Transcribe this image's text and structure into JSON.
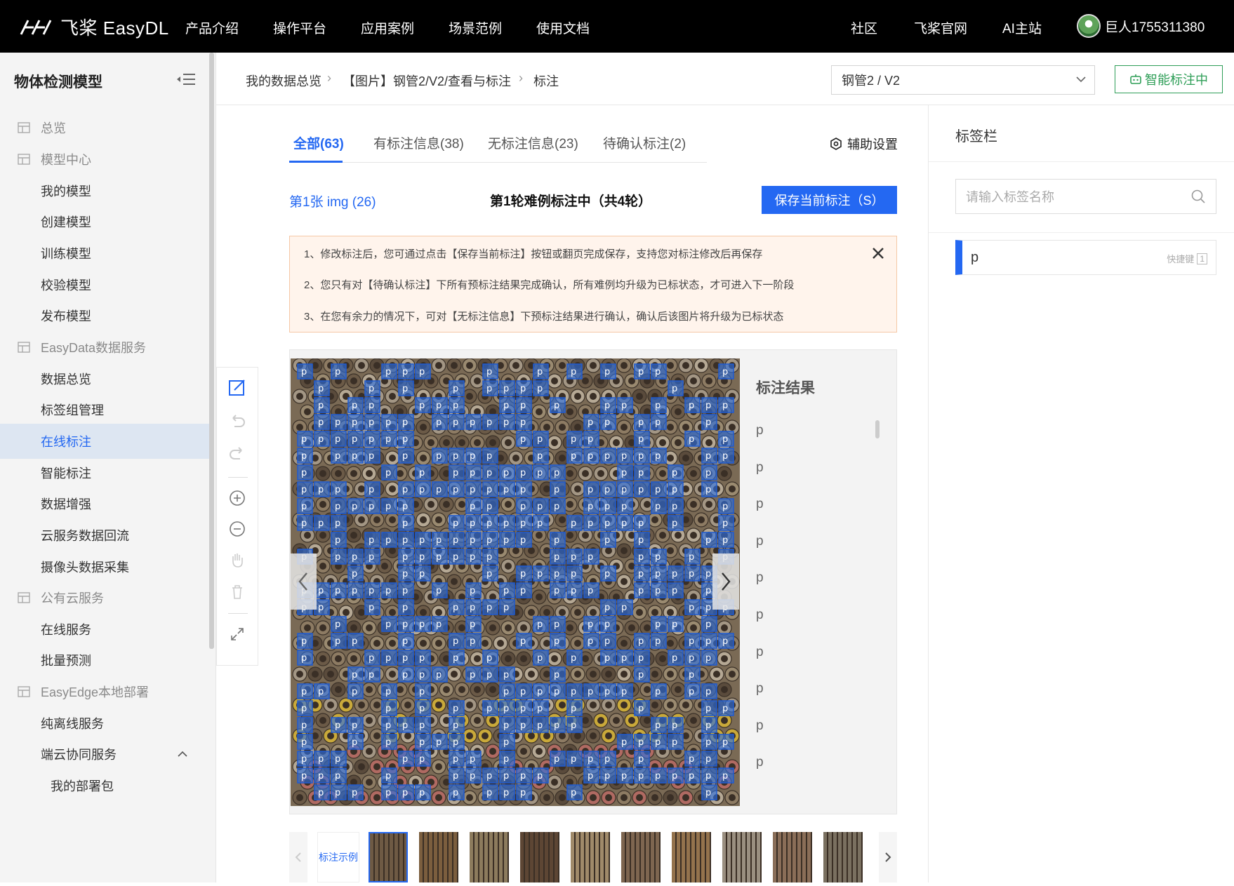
{
  "brand": {
    "logo_text": "飞桨 EasyDL"
  },
  "topnav": {
    "items": [
      "产品介绍",
      "操作平台",
      "应用案例",
      "场景范例",
      "使用文档"
    ],
    "right_items": [
      "社区",
      "飞桨官网",
      "AI主站"
    ],
    "user": "巨人1755311380"
  },
  "sidebar": {
    "title": "物体检测模型",
    "items": [
      {
        "label": "总览",
        "kind": "group"
      },
      {
        "label": "模型中心",
        "kind": "group"
      },
      {
        "label": "我的模型",
        "kind": "sub"
      },
      {
        "label": "创建模型",
        "kind": "sub"
      },
      {
        "label": "训练模型",
        "kind": "sub"
      },
      {
        "label": "校验模型",
        "kind": "sub"
      },
      {
        "label": "发布模型",
        "kind": "sub"
      },
      {
        "label": "EasyData数据服务",
        "kind": "group"
      },
      {
        "label": "数据总览",
        "kind": "sub"
      },
      {
        "label": "标签组管理",
        "kind": "sub"
      },
      {
        "label": "在线标注",
        "kind": "sub",
        "active": true
      },
      {
        "label": "智能标注",
        "kind": "sub"
      },
      {
        "label": "数据增强",
        "kind": "sub"
      },
      {
        "label": "云服务数据回流",
        "kind": "sub"
      },
      {
        "label": "摄像头数据采集",
        "kind": "sub"
      },
      {
        "label": "公有云服务",
        "kind": "group"
      },
      {
        "label": "在线服务",
        "kind": "sub"
      },
      {
        "label": "批量预测",
        "kind": "sub"
      },
      {
        "label": "EasyEdge本地部署",
        "kind": "group"
      },
      {
        "label": "纯离线服务",
        "kind": "sub"
      },
      {
        "label": "端云协同服务",
        "kind": "sub"
      },
      {
        "label": "我的部署包",
        "kind": "sub2"
      }
    ]
  },
  "breadcrumb": [
    "我的数据总览",
    "【图片】钢管2/V2/查看与标注",
    "标注"
  ],
  "version_select": {
    "value": "钢管2 / V2"
  },
  "smart_label_button": "智能标注中",
  "tabs": [
    {
      "label": "全部(63)",
      "active": true
    },
    {
      "label": "有标注信息(38)"
    },
    {
      "label": "无标注信息(23)"
    },
    {
      "label": "待确认标注(2)"
    }
  ],
  "assist_settings": "辅助设置",
  "image_index": "第1张 img (26)",
  "round_status": "第1轮难例标注中（共4轮）",
  "save_button": "保存当前标注（S）",
  "notice": [
    "1、修改标注后，您可通过点击【保存当前标注】按钮或翻页完成保存，支持您对标注修改后再保存",
    "2、您只有对【待确认标注】下所有预标注结果完成确认，所有难例均升级为已标状态，才可进入下一阶段",
    "3、在您有余力的情况下，可对【无标注信息】下预标注结果进行确认，确认后该图片将升级为已标状态"
  ],
  "results": {
    "title": "标注结果",
    "items": [
      "p",
      "p",
      "p",
      "p",
      "p",
      "p",
      "p",
      "p",
      "p",
      "p"
    ]
  },
  "thumbnails": {
    "example_label": "标注示例",
    "count": 10,
    "selected_index": 0
  },
  "right_panel": {
    "title": "标签栏",
    "search_placeholder": "请输入标签名称",
    "tags": [
      {
        "name": "p",
        "hotkey_label": "快捷键",
        "hotkey": "1"
      }
    ]
  },
  "colors": {
    "accent": "#2468f2",
    "smart_green": "#2e9e57",
    "notice_bg": "#fff4ec",
    "box": "#2d6fe0"
  }
}
